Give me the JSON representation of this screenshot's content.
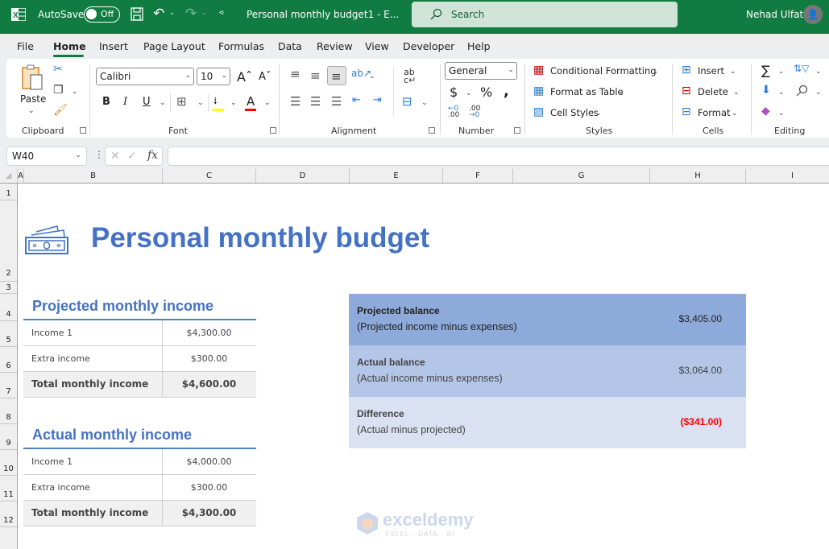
{
  "titlebar": {
    "autosave_label": "AutoSave",
    "autosave_state": "Off",
    "document_title": "Personal monthly budget1  -  E...",
    "search_placeholder": "Search",
    "user_name": "Nehad Ulfat",
    "avatar_glyph": "Α"
  },
  "menu": {
    "items": [
      "File",
      "Home",
      "Insert",
      "Page Layout",
      "Formulas",
      "Data",
      "Review",
      "View",
      "Developer",
      "Help"
    ],
    "active": "Home"
  },
  "ribbon": {
    "clipboard": {
      "paste_label": "Paste",
      "group_label": "Clipboard"
    },
    "font": {
      "font_name": "Calibri",
      "font_size": "10",
      "group_label": "Font",
      "highlight_color": "#ffff00",
      "font_color": "#ff0000"
    },
    "alignment": {
      "group_label": "Alignment"
    },
    "number": {
      "format": "General",
      "group_label": "Number"
    },
    "styles": {
      "conditional_formatting": "Conditional Formatting",
      "format_as_table": "Format as Table",
      "cell_styles": "Cell Styles",
      "group_label": "Styles"
    },
    "cells": {
      "insert": "Insert",
      "delete": "Delete",
      "format": "Format",
      "group_label": "Cells"
    },
    "editing": {
      "group_label": "Editing"
    }
  },
  "formula_bar": {
    "name_box": "W40",
    "fx_label": "fx",
    "formula": ""
  },
  "columns": [
    "A",
    "B",
    "C",
    "D",
    "E",
    "F",
    "G",
    "H",
    "I"
  ],
  "rows": [
    "1",
    "2",
    "3",
    "4",
    "5",
    "6",
    "7",
    "8",
    "9",
    "10",
    "11",
    "12"
  ],
  "sheet": {
    "title": "Personal monthly budget",
    "projected_income": {
      "heading": "Projected monthly income",
      "rows": [
        {
          "label": "Income 1",
          "value": "$4,300.00"
        },
        {
          "label": "Extra income",
          "value": "$300.00"
        }
      ],
      "total": {
        "label": "Total monthly income",
        "value": "$4,600.00"
      }
    },
    "actual_income": {
      "heading": "Actual monthly income",
      "rows": [
        {
          "label": "Income 1",
          "value": "$4,000.00"
        },
        {
          "label": "Extra income",
          "value": "$300.00"
        }
      ],
      "total": {
        "label": "Total monthly income",
        "value": "$4,300.00"
      }
    },
    "balances": [
      {
        "title": "Projected balance",
        "subtitle": "(Projected income minus expenses)",
        "value": "$3,405.00",
        "bg": "#8eaadb"
      },
      {
        "title": "Actual balance",
        "subtitle": "(Actual income minus expenses)",
        "value": "$3,064.00",
        "bg": "#b4c6e7"
      },
      {
        "title": "Difference",
        "subtitle": "(Actual minus projected)",
        "value": "($341.00)",
        "bg": "#d9e1f2",
        "value_color": "#ff0000"
      }
    ],
    "accent_color": "#4472c4"
  },
  "watermark": {
    "name": "exceldemy",
    "tagline": "EXCEL - DATA - BI"
  }
}
